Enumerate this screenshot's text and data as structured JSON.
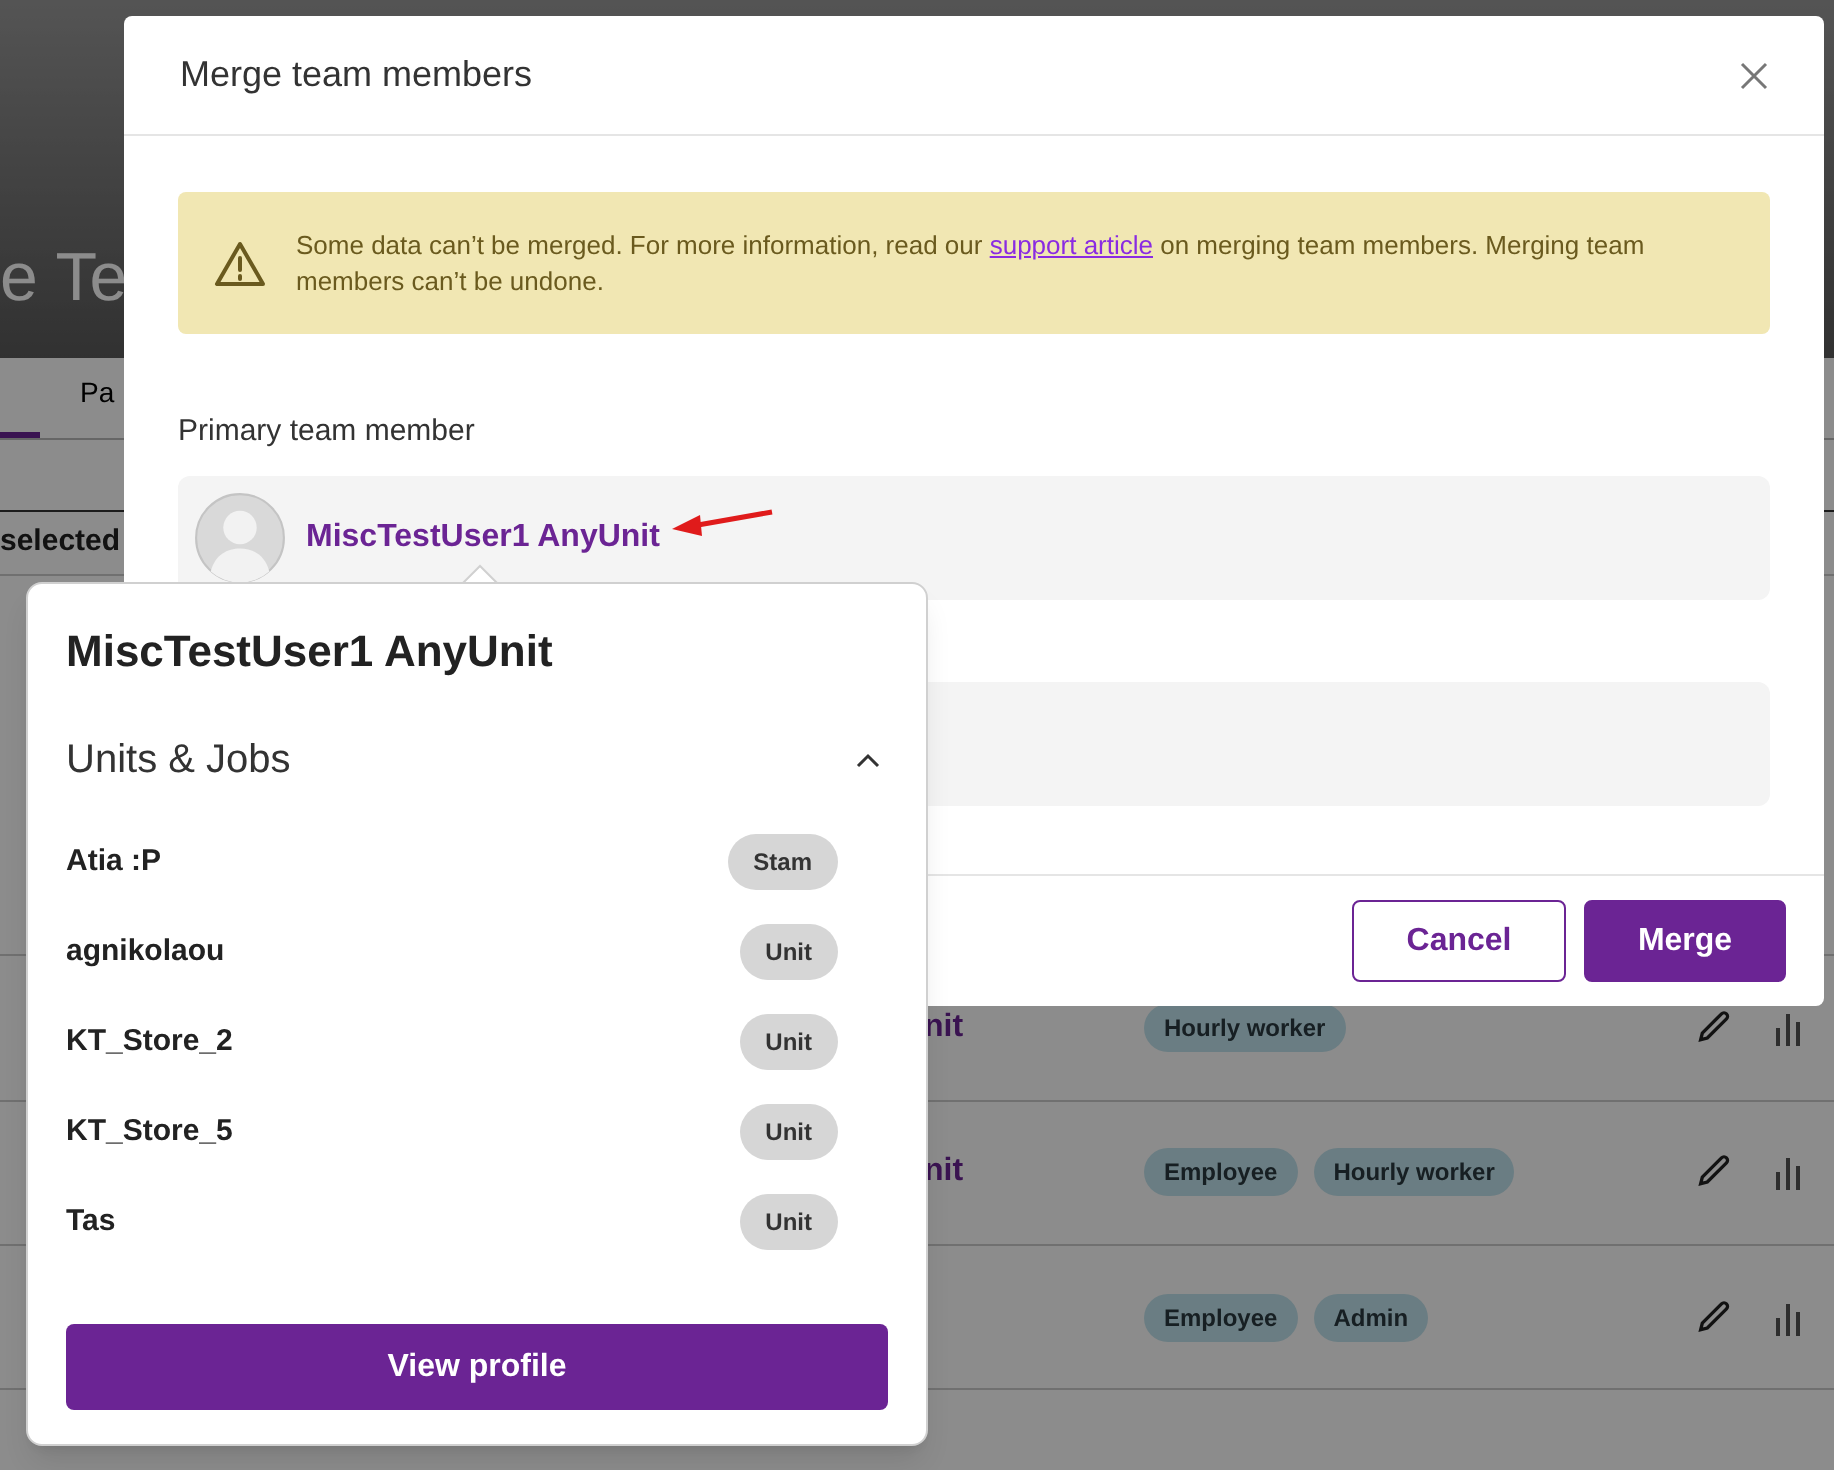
{
  "background_page": {
    "heading": "e Te",
    "tabs": [
      {
        "label": "Pa",
        "selected": false
      }
    ],
    "selection_label": "selected",
    "rows": [
      {
        "name": "nit",
        "tags": [
          "Hourly worker"
        ]
      },
      {
        "name": "nit",
        "tags": [
          "Employee",
          "Hourly worker"
        ]
      },
      {
        "tags": [
          "Employee",
          "Admin"
        ]
      }
    ]
  },
  "dialog": {
    "title": "Merge team members",
    "alert": {
      "before": "Some data can’t be merged. For more information, read our ",
      "link": "support article",
      "after": " on merging team members. Merging team members can’t be undone."
    },
    "primary_label": "Primary team member",
    "primary_member": {
      "name": "MiscTestUser1 AnyUnit"
    },
    "buttons": [
      {
        "label": "Cancel",
        "kind": "secondary"
      },
      {
        "label": "Merge",
        "kind": "primary"
      }
    ]
  },
  "profile_popover": {
    "name": "MiscTestUser1 AnyUnit",
    "section": {
      "title": "Units & Jobs",
      "expanded": true,
      "items": [
        {
          "name": "Atia :P",
          "badge": "Stam"
        },
        {
          "name": "agnikolaou",
          "badge": "Unit"
        },
        {
          "name": "KT_Store_2",
          "badge": "Unit"
        },
        {
          "name": "KT_Store_5",
          "badge": "Unit"
        },
        {
          "name": "Tas",
          "badge": "Unit"
        }
      ]
    },
    "button": "View profile"
  }
}
